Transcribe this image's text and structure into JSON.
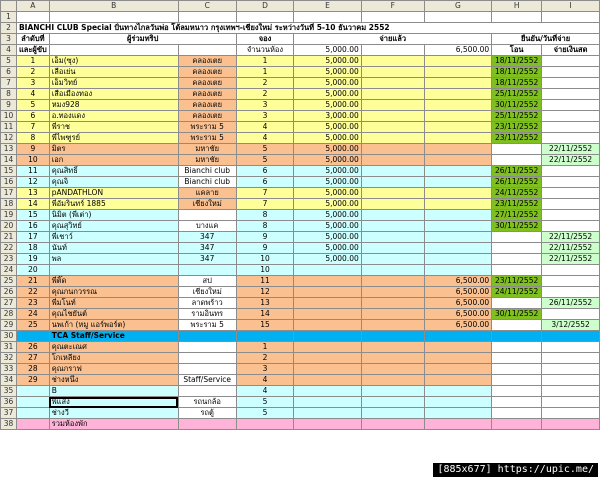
{
  "columns": [
    "A",
    "B",
    "C",
    "D",
    "E",
    "F",
    "G",
    "H",
    "I"
  ],
  "row_numbers": [
    "1",
    "2",
    "3",
    "4",
    "5",
    "6",
    "7",
    "8",
    "9",
    "10",
    "11",
    "12",
    "13",
    "14",
    "15",
    "16",
    "17",
    "18",
    "19",
    "20",
    "21",
    "22",
    "23",
    "24",
    "25",
    "26",
    "27",
    "28",
    "29",
    "30",
    "31",
    "32",
    "33",
    "34",
    "35",
    "36",
    "37",
    "38"
  ],
  "title": "BIANCHI CLUB Special ปั่นทางไกลวันพ่อ โต้ลมหนาว กรุงเทพฯ-เชียงใหม่ ระหว่างวันที่ 5-10 ธันวาคม 2552",
  "headers": {
    "seq": "ลำดับที่",
    "participant": "ผู้ร่วมทริป",
    "booking": "จอง",
    "paid": "จ่ายแล้ว",
    "confirm_date": "ยืนยัน/วันที่จ่าย",
    "team_leader": "และผู้ขับ",
    "room_count": "จำนวนห้อง",
    "deposit": "5,000.00",
    "balance": "6,500.00",
    "transfer": "โอน",
    "cash": "จ่ายเงินสด"
  },
  "rows": [
    {
      "a": "1",
      "b": "เอ็ม(ซุง)",
      "c": "คลองเตย",
      "d": "1",
      "e": "5,000.00",
      "f": "",
      "g": "",
      "h": "18/11/2552",
      "i": ""
    },
    {
      "a": "2",
      "b": "เลือเย่น",
      "c": "คลองเตย",
      "d": "1",
      "e": "5,000.00",
      "f": "",
      "g": "",
      "h": "18/11/2552",
      "i": ""
    },
    {
      "a": "3",
      "b": "เอ็มวิทย์",
      "c": "คลองเตย",
      "d": "2",
      "e": "5,000.00",
      "f": "",
      "g": "",
      "h": "18/11/2552",
      "i": ""
    },
    {
      "a": "4",
      "b": "เสือเมืองทอง",
      "c": "คลองเตย",
      "d": "2",
      "e": "5,000.00",
      "f": "",
      "g": "",
      "h": "25/11/2552",
      "i": ""
    },
    {
      "a": "5",
      "b": "หมง928",
      "c": "คลองเตย",
      "d": "3",
      "e": "5,000.00",
      "f": "",
      "g": "",
      "h": "30/11/2552",
      "i": ""
    },
    {
      "a": "6",
      "b": "อ.ทองแดง",
      "c": "คลองเตย",
      "d": "3",
      "e": "3,000.00",
      "f": "",
      "g": "",
      "h": "25/11/2552",
      "i": ""
    },
    {
      "a": "7",
      "b": "พี่ราช",
      "c": "พระราม 5",
      "d": "4",
      "e": "5,000.00",
      "f": "",
      "g": "",
      "h": "23/11/2552",
      "i": ""
    },
    {
      "a": "8",
      "b": "พี่ไพฑูรย์",
      "c": "พระราม 5",
      "d": "4",
      "e": "5,000.00",
      "f": "",
      "g": "",
      "h": "23/11/2552",
      "i": ""
    },
    {
      "a": "9",
      "b": "มิตร",
      "c": "มหาชัย",
      "d": "5",
      "e": "5,000.00",
      "f": "",
      "g": "",
      "h": "",
      "i": "22/11/2552"
    },
    {
      "a": "10",
      "b": "เอก",
      "c": "มหาชัย",
      "d": "5",
      "e": "5,000.00",
      "f": "",
      "g": "",
      "h": "",
      "i": "22/11/2552"
    },
    {
      "a": "11",
      "b": "คุณสิทธิ์",
      "c": "Bianchi club",
      "d": "6",
      "e": "5,000.00",
      "f": "",
      "g": "",
      "h": "26/11/2552",
      "i": ""
    },
    {
      "a": "12",
      "b": "คุณจิ",
      "c": "Bianchi club",
      "d": "6",
      "e": "5,000.00",
      "f": "",
      "g": "",
      "h": "26/11/2552",
      "i": ""
    },
    {
      "a": "13",
      "b": "pANDATHLON",
      "c": "แคลาย",
      "d": "7",
      "e": "5,000.00",
      "f": "",
      "g": "",
      "h": "24/11/2552",
      "i": ""
    },
    {
      "a": "14",
      "b": "พี่อัมรินทร์ 1885",
      "c": "เชียงใหม่",
      "d": "7",
      "e": "5,000.00",
      "f": "",
      "g": "",
      "h": "23/11/2552",
      "i": ""
    },
    {
      "a": "15",
      "b": "นิมิต (พี่เต่า)",
      "c": "",
      "d": "8",
      "e": "5,000.00",
      "f": "",
      "g": "",
      "h": "27/11/2552",
      "i": ""
    },
    {
      "a": "16",
      "b": "คุณสุวิทย์",
      "c": "บางแค",
      "d": "8",
      "e": "5,000.00",
      "f": "",
      "g": "",
      "h": "30/11/2552",
      "i": ""
    },
    {
      "a": "17",
      "b": "พี่เชาว์",
      "c": "347",
      "d": "9",
      "e": "5,000.00",
      "f": "",
      "g": "",
      "h": "",
      "i": "22/11/2552"
    },
    {
      "a": "18",
      "b": "นันท์",
      "c": "347",
      "d": "9",
      "e": "5,000.00",
      "f": "",
      "g": "",
      "h": "",
      "i": "22/11/2552"
    },
    {
      "a": "19",
      "b": "พล",
      "c": "347",
      "d": "10",
      "e": "5,000.00",
      "f": "",
      "g": "",
      "h": "",
      "i": "22/11/2552"
    },
    {
      "a": "20",
      "b": "",
      "c": "",
      "d": "10",
      "e": "",
      "f": "",
      "g": "",
      "h": "",
      "i": ""
    },
    {
      "a": "21",
      "b": "พี่ติ๊ด",
      "c": "สป",
      "d": "11",
      "e": "",
      "f": "",
      "g": "6,500.00",
      "h": "23/11/2552",
      "i": ""
    },
    {
      "a": "22",
      "b": "คุณกนกวรรณ",
      "c": "เชียงใหม่",
      "d": "12",
      "e": "",
      "f": "",
      "g": "6,500.00",
      "h": "24/11/2552",
      "i": ""
    },
    {
      "a": "23",
      "b": "พี่มโนท์",
      "c": "ลาดพร้าว",
      "d": "13",
      "e": "",
      "f": "",
      "g": "6,500.00",
      "h": "",
      "i": "26/11/2552"
    },
    {
      "a": "24",
      "b": "คุณไชยันต์",
      "c": "รามอินทร",
      "d": "14",
      "e": "",
      "f": "",
      "g": "6,500.00",
      "h": "30/11/2552",
      "i": ""
    },
    {
      "a": "25",
      "b": "นพเก้า (หมู แอร์พอร์ต)",
      "c": "พระราม 5",
      "d": "15",
      "e": "",
      "f": "",
      "g": "6,500.00",
      "h": "",
      "i": "3/12/2552"
    },
    {
      "a": "",
      "b": "TCA Staff/Service",
      "c": "",
      "d": "",
      "e": "",
      "f": "",
      "g": "",
      "h": "",
      "i": ""
    },
    {
      "a": "26",
      "b": "คุณตะเณศ",
      "c": "",
      "d": "1",
      "e": "",
      "f": "",
      "g": "",
      "h": "",
      "i": ""
    },
    {
      "a": "27",
      "b": "โกเหลียง",
      "c": "",
      "d": "2",
      "e": "",
      "f": "",
      "g": "",
      "h": "",
      "i": ""
    },
    {
      "a": "28",
      "b": "คุณกราฟ",
      "c": "",
      "d": "3",
      "e": "",
      "f": "",
      "g": "",
      "h": "",
      "i": ""
    },
    {
      "a": "29",
      "b": "ช่างหนึ่ง",
      "c": "Staff/Service",
      "d": "4",
      "e": "",
      "f": "",
      "g": "",
      "h": "",
      "i": ""
    },
    {
      "a": "",
      "b": "B",
      "c": "",
      "d": "4",
      "e": "",
      "f": "",
      "g": "",
      "h": "",
      "i": ""
    },
    {
      "a": "",
      "b": "พี่แสง",
      "c": "รถนกล้อ",
      "d": "5",
      "e": "",
      "f": "",
      "g": "",
      "h": "",
      "i": ""
    },
    {
      "a": "",
      "b": "ช่างวี",
      "c": "รถตู้",
      "d": "5",
      "e": "",
      "f": "",
      "g": "",
      "h": "",
      "i": ""
    },
    {
      "a": "",
      "b": "รวมห้องพัก",
      "c": "",
      "d": "",
      "e": "",
      "f": "",
      "g": "",
      "h": "",
      "i": ""
    }
  ],
  "watermark": "[885x677] https://upic.me/",
  "colors": {
    "header_grey": "#ece9d8",
    "yellow": "#ffff99",
    "orange": "#fac090",
    "cyan": "#ccffff",
    "pink": "#ffb3d9",
    "blue": "#00b0f0",
    "green": "#7fbf1f",
    "light_green": "#ccffcc"
  }
}
